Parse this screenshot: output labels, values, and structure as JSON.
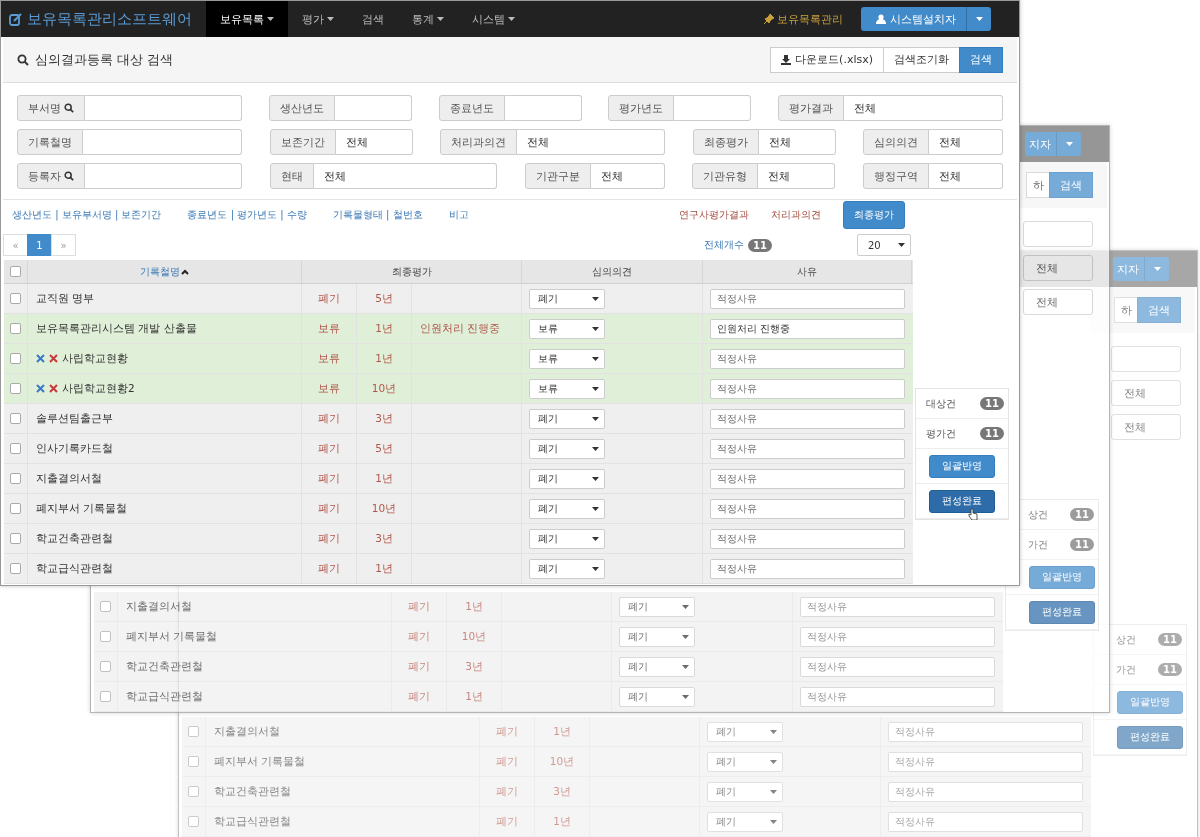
{
  "app": {
    "brand": "보유목록관리소프트웨어",
    "nav": [
      {
        "label": "보유목록",
        "dropdown": true,
        "selected": true
      },
      {
        "label": "평가",
        "dropdown": true,
        "selected": false
      },
      {
        "label": "검색",
        "dropdown": false,
        "selected": false
      },
      {
        "label": "통계",
        "dropdown": true,
        "selected": false
      },
      {
        "label": "시스템",
        "dropdown": true,
        "selected": false
      }
    ],
    "shortcut": "보유목록관리",
    "user_button": "시스템설치자"
  },
  "search_panel": {
    "title": "심의결과등록 대상 검색",
    "buttons": [
      {
        "label": "다운로드(.xlsx)",
        "kind": "download"
      },
      {
        "label": "검색조기화",
        "kind": "default"
      },
      {
        "label": "검색",
        "kind": "primary"
      }
    ],
    "filters": [
      [
        {
          "label": "부서명",
          "kind": "search"
        },
        {
          "label": "생산년도",
          "kind": "plain"
        },
        {
          "label": "종료년도",
          "kind": "plain"
        },
        {
          "label": "평가년도",
          "kind": "plain"
        },
        {
          "label": "평가결과",
          "kind": "plain",
          "value": "전체"
        }
      ],
      [
        {
          "label": "기록철명",
          "kind": "plain"
        },
        {
          "label": "보존기간",
          "kind": "plain",
          "value": "전체"
        },
        {
          "label": "처리과의견",
          "kind": "plain",
          "value": "전체"
        },
        {
          "label": "최종평가",
          "kind": "plain",
          "value": "전체"
        },
        {
          "label": "심의의견",
          "kind": "plain",
          "value": "전체"
        }
      ],
      [
        {
          "label": "등록자",
          "kind": "search"
        },
        {
          "label": "현태",
          "kind": "plain",
          "value": "전체"
        },
        {
          "label": "기관구분",
          "kind": "plain",
          "value": "전체"
        },
        {
          "label": "기관유형",
          "kind": "plain",
          "value": "전체"
        },
        {
          "label": "행정구역",
          "kind": "plain",
          "value": "전체"
        }
      ]
    ]
  },
  "column_toggles": [
    "생산년도 | 보유부서명 | 보존기간",
    "종료년도 | 평가년도 | 수량",
    "기록물형태 | 철번호",
    "비고"
  ],
  "evaluation_tabs": [
    {
      "label": "연구사평가결과",
      "selected": false
    },
    {
      "label": "처리과의견",
      "selected": false
    },
    {
      "label": "최종평가",
      "selected": true
    }
  ],
  "pagination": {
    "prev": "«",
    "pages": [
      {
        "label": "1",
        "selected": true
      }
    ],
    "next": "»"
  },
  "total": {
    "label": "전체개수",
    "count": "11"
  },
  "page_size": "20",
  "table": {
    "all_checked": false,
    "columns": [
      {
        "label": "기록철명",
        "sorted": true
      },
      {
        "label": "최종평가",
        "sorted": false
      },
      {
        "label": "심의의견",
        "sorted": false
      },
      {
        "label": "사유",
        "sorted": false
      }
    ],
    "rows": [
      {
        "name": "교직원 명부",
        "checked": false,
        "actions": false,
        "highlighted": false,
        "verdict": "폐기",
        "period": "5년",
        "opinion": "폐기",
        "placeholder": "적정사유"
      },
      {
        "name": "보유목록관리시스템 개발 산출물",
        "checked": false,
        "actions": false,
        "highlighted": true,
        "verdict": "보류",
        "period": "1년",
        "note": "인원처리 진행중",
        "opinion": "보류",
        "reason": "인원처리 진행중"
      },
      {
        "name": "사립학교현황",
        "checked": false,
        "actions": true,
        "highlighted": true,
        "verdict": "보류",
        "period": "1년",
        "opinion": "보류",
        "placeholder": "적정사유"
      },
      {
        "name": "사립학교현황2",
        "checked": false,
        "actions": true,
        "highlighted": true,
        "verdict": "보류",
        "period": "10년",
        "opinion": "보류",
        "placeholder": "적정사유"
      },
      {
        "name": "솔루션팀출근부",
        "checked": false,
        "actions": false,
        "highlighted": false,
        "verdict": "폐기",
        "period": "3년",
        "opinion": "폐기",
        "placeholder": "적정사유"
      },
      {
        "name": "인사기록카드철",
        "checked": false,
        "actions": false,
        "highlighted": false,
        "verdict": "폐기",
        "period": "5년",
        "opinion": "폐기",
        "placeholder": "적정사유"
      },
      {
        "name": "지출결의서철",
        "checked": false,
        "actions": false,
        "highlighted": false,
        "verdict": "폐기",
        "period": "1년",
        "opinion": "폐기",
        "placeholder": "적정사유"
      },
      {
        "name": "폐지부서 기록물철",
        "checked": false,
        "actions": false,
        "highlighted": false,
        "verdict": "폐기",
        "period": "10년",
        "opinion": "폐기",
        "placeholder": "적정사유"
      },
      {
        "name": "학교건축관련철",
        "checked": false,
        "actions": false,
        "highlighted": false,
        "verdict": "폐기",
        "period": "3년",
        "opinion": "폐기",
        "placeholder": "적정사유"
      },
      {
        "name": "학교급식관련철",
        "checked": false,
        "actions": false,
        "highlighted": false,
        "verdict": "폐기",
        "period": "1년",
        "opinion": "폐기",
        "placeholder": "적정사유"
      }
    ]
  },
  "summary": {
    "items": [
      {
        "label": "대상건",
        "count": "11"
      },
      {
        "label": "평가건",
        "count": "11"
      }
    ],
    "buttons": [
      {
        "label": "일괄반영",
        "pressed": false
      },
      {
        "label": "편성완료",
        "pressed": true
      }
    ]
  },
  "background_windows": [
    {
      "user_button": "지자",
      "reset_button": "하",
      "search_button": "검색",
      "filters": [
        "전체",
        "전체"
      ],
      "summary": [
        {
          "label": "상건",
          "count": "11"
        },
        {
          "label": "가건",
          "count": "11"
        }
      ],
      "buttons": [
        "일괄반영",
        "편성완료"
      ],
      "rows": [
        {
          "name": "지출결의서철",
          "checked": false,
          "verdict": "폐기",
          "period": "1년",
          "opinion": "폐기",
          "placeholder": "적정사유"
        },
        {
          "name": "폐지부서 기록물철",
          "checked": false,
          "verdict": "폐기",
          "period": "10년",
          "opinion": "폐기",
          "placeholder": "적정사유"
        },
        {
          "name": "학교건축관련철",
          "checked": false,
          "verdict": "폐기",
          "period": "3년",
          "opinion": "폐기",
          "placeholder": "적정사유"
        },
        {
          "name": "학교급식관련철",
          "checked": false,
          "verdict": "폐기",
          "period": "1년",
          "opinion": "폐기",
          "placeholder": "적정사유"
        }
      ]
    },
    {
      "user_button": "지자",
      "reset_button": "하",
      "search_button": "검색",
      "filters": [
        "전체",
        "전체"
      ],
      "summary": [
        {
          "label": "상건",
          "count": "11"
        },
        {
          "label": "가건",
          "count": "11"
        }
      ],
      "buttons": [
        "일괄반영",
        "편성완료"
      ],
      "rows": [
        {
          "name": "지출결의서철",
          "checked": false,
          "verdict": "폐기",
          "period": "1년",
          "opinion": "폐기",
          "placeholder": "적정사유"
        },
        {
          "name": "폐지부서 기록물철",
          "checked": false,
          "verdict": "폐기",
          "period": "10년",
          "opinion": "폐기",
          "placeholder": "적정사유"
        },
        {
          "name": "학교건축관련철",
          "checked": false,
          "verdict": "폐기",
          "period": "3년",
          "opinion": "폐기",
          "placeholder": "적정사유"
        },
        {
          "name": "학교급식관련철",
          "checked": false,
          "verdict": "폐기",
          "period": "1년",
          "opinion": "폐기",
          "placeholder": "적정사유"
        }
      ]
    }
  ]
}
